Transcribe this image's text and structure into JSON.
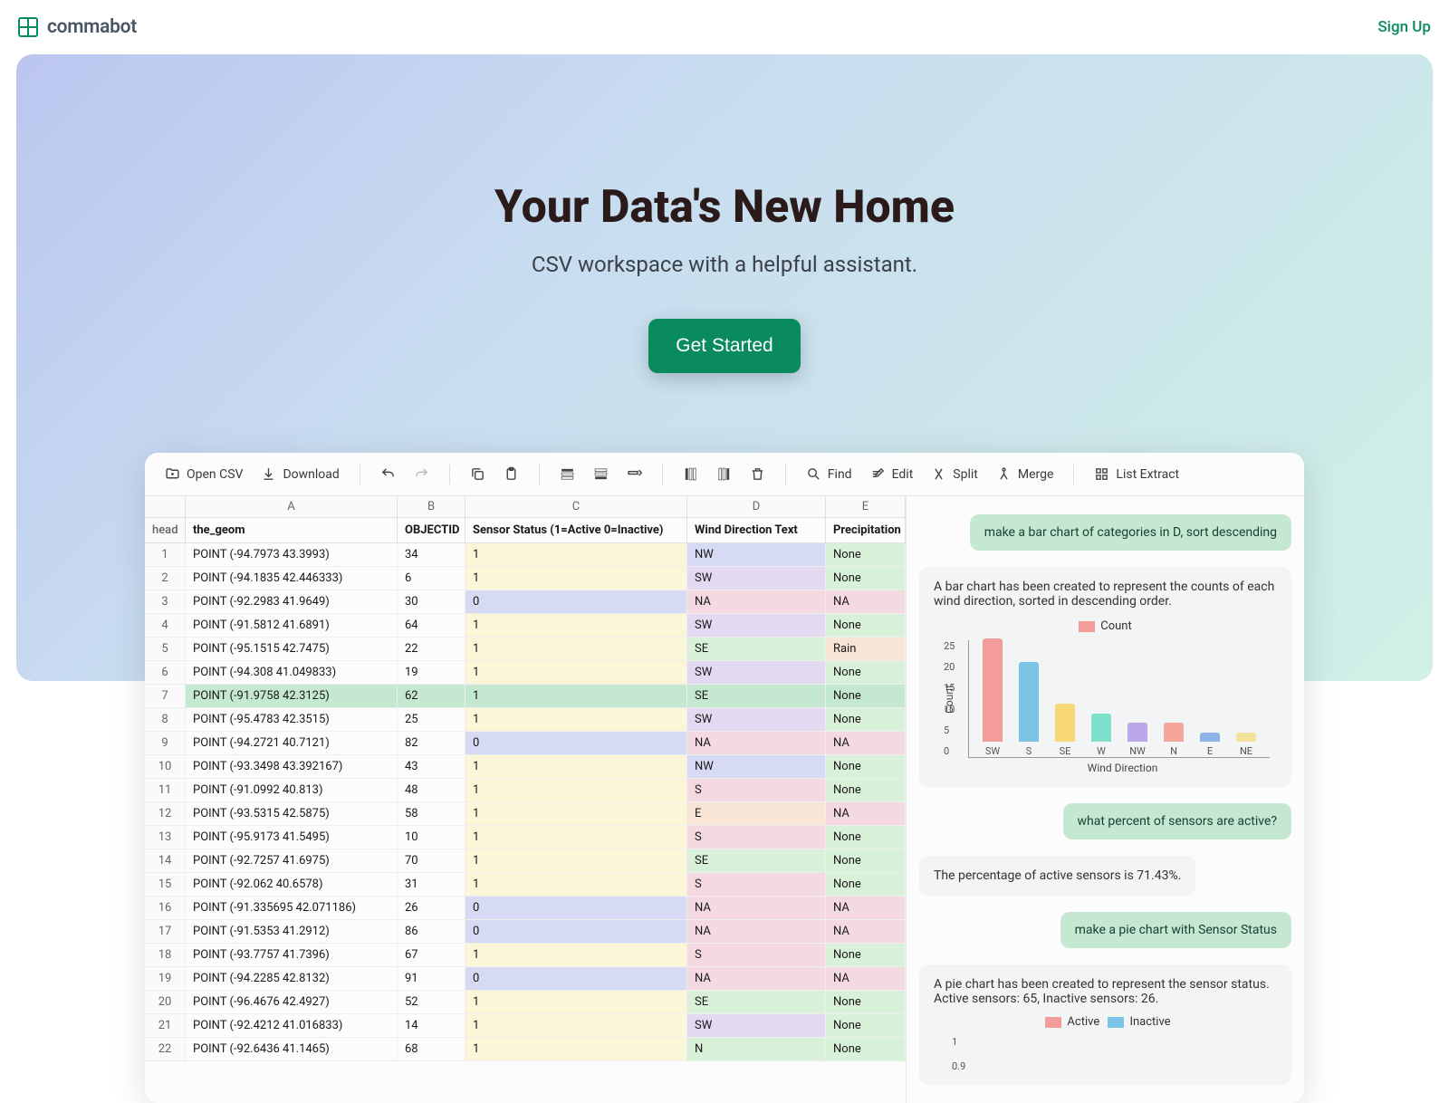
{
  "nav": {
    "brand": "commabot",
    "signup": "Sign Up"
  },
  "hero": {
    "title": "Your Data's New Home",
    "subtitle": "CSV workspace with a helpful assistant.",
    "cta": "Get Started"
  },
  "toolbar": {
    "open": "Open CSV",
    "download": "Download",
    "find": "Find",
    "edit": "Edit",
    "split": "Split",
    "merge": "Merge",
    "extract": "List Extract"
  },
  "sheet": {
    "cols": [
      "A",
      "B",
      "C",
      "D",
      "E"
    ],
    "head_label": "head",
    "headers": [
      "the_geom",
      "OBJECTID",
      "Sensor Status (1=Active 0=Inactive)",
      "Wind Direction Text",
      "Precipitation"
    ],
    "rows": [
      {
        "n": "1",
        "geom": "POINT (-94.7973 43.3993)",
        "id": "34",
        "status": "1",
        "dir": "NW",
        "precip": "None"
      },
      {
        "n": "2",
        "geom": "POINT (-94.1835 42.446333)",
        "id": "6",
        "status": "1",
        "dir": "SW",
        "precip": "None"
      },
      {
        "n": "3",
        "geom": "POINT (-92.2983 41.9649)",
        "id": "30",
        "status": "0",
        "dir": "NA",
        "precip": "NA"
      },
      {
        "n": "4",
        "geom": "POINT (-91.5812 41.6891)",
        "id": "64",
        "status": "1",
        "dir": "SW",
        "precip": "None"
      },
      {
        "n": "5",
        "geom": "POINT (-95.1515 42.7475)",
        "id": "22",
        "status": "1",
        "dir": "SE",
        "precip": "Rain"
      },
      {
        "n": "6",
        "geom": "POINT (-94.308 41.049833)",
        "id": "19",
        "status": "1",
        "dir": "SW",
        "precip": "None"
      },
      {
        "n": "7",
        "geom": "POINT (-91.9758 42.3125)",
        "id": "62",
        "status": "1",
        "dir": "SE",
        "precip": "None",
        "hl": true
      },
      {
        "n": "8",
        "geom": "POINT (-95.4783 42.3515)",
        "id": "25",
        "status": "1",
        "dir": "SW",
        "precip": "None"
      },
      {
        "n": "9",
        "geom": "POINT (-94.2721 40.7121)",
        "id": "82",
        "status": "0",
        "dir": "NA",
        "precip": "NA"
      },
      {
        "n": "10",
        "geom": "POINT (-93.3498 43.392167)",
        "id": "43",
        "status": "1",
        "dir": "NW",
        "precip": "None"
      },
      {
        "n": "11",
        "geom": "POINT (-91.0992 40.813)",
        "id": "48",
        "status": "1",
        "dir": "S",
        "precip": "None"
      },
      {
        "n": "12",
        "geom": "POINT (-93.5315 42.5875)",
        "id": "58",
        "status": "1",
        "dir": "E",
        "precip": "NA"
      },
      {
        "n": "13",
        "geom": "POINT (-95.9173 41.5495)",
        "id": "10",
        "status": "1",
        "dir": "S",
        "precip": "None"
      },
      {
        "n": "14",
        "geom": "POINT (-92.7257 41.6975)",
        "id": "70",
        "status": "1",
        "dir": "SE",
        "precip": "None"
      },
      {
        "n": "15",
        "geom": "POINT (-92.062 40.6578)",
        "id": "31",
        "status": "1",
        "dir": "S",
        "precip": "None"
      },
      {
        "n": "16",
        "geom": "POINT (-91.335695 42.071186)",
        "id": "26",
        "status": "0",
        "dir": "NA",
        "precip": "NA"
      },
      {
        "n": "17",
        "geom": "POINT (-91.5353 41.2912)",
        "id": "86",
        "status": "0",
        "dir": "NA",
        "precip": "NA"
      },
      {
        "n": "18",
        "geom": "POINT (-93.7757 41.7396)",
        "id": "67",
        "status": "1",
        "dir": "S",
        "precip": "None"
      },
      {
        "n": "19",
        "geom": "POINT (-94.2285 42.8132)",
        "id": "91",
        "status": "0",
        "dir": "NA",
        "precip": "NA"
      },
      {
        "n": "20",
        "geom": "POINT (-96.4676 42.4927)",
        "id": "52",
        "status": "1",
        "dir": "SE",
        "precip": "None"
      },
      {
        "n": "21",
        "geom": "POINT (-92.4212 41.016833)",
        "id": "14",
        "status": "1",
        "dir": "SW",
        "precip": "None"
      },
      {
        "n": "22",
        "geom": "POINT (-92.6436 41.1465)",
        "id": "68",
        "status": "1",
        "dir": "N",
        "precip": "None"
      }
    ]
  },
  "chat": {
    "m1": "make a bar chart of categories in D, sort descending",
    "r1": "A bar chart has been created to represent the counts of each wind direction, sorted in descending order.",
    "m2": "what percent of sensors are active?",
    "r2": "The percentage of active sensors is 71.43%.",
    "m3": "make a pie chart with Sensor Status",
    "r3": "A pie chart has been created to represent the sensor status. Active sensors: 65, Inactive sensors: 26.",
    "legend_count": "Count",
    "legend_active": "Active",
    "legend_inactive": "Inactive",
    "xlabel": "Wind Direction",
    "ylabel": "Count",
    "pie_tick1": "1",
    "pie_tick2": "0.9"
  },
  "chart_data": {
    "type": "bar",
    "title": "Count",
    "xlabel": "Wind Direction",
    "ylabel": "Count",
    "ylim": [
      0,
      25
    ],
    "categories": [
      "SW",
      "S",
      "SE",
      "W",
      "NW",
      "N",
      "E",
      "NE"
    ],
    "values": [
      22,
      17,
      8,
      6,
      4,
      4,
      2,
      2
    ],
    "colors": [
      "#f49c9c",
      "#7bc4e8",
      "#f8d776",
      "#7de0c9",
      "#bba8e8",
      "#f4a69c",
      "#8cb3e8",
      "#f2e29a"
    ]
  }
}
